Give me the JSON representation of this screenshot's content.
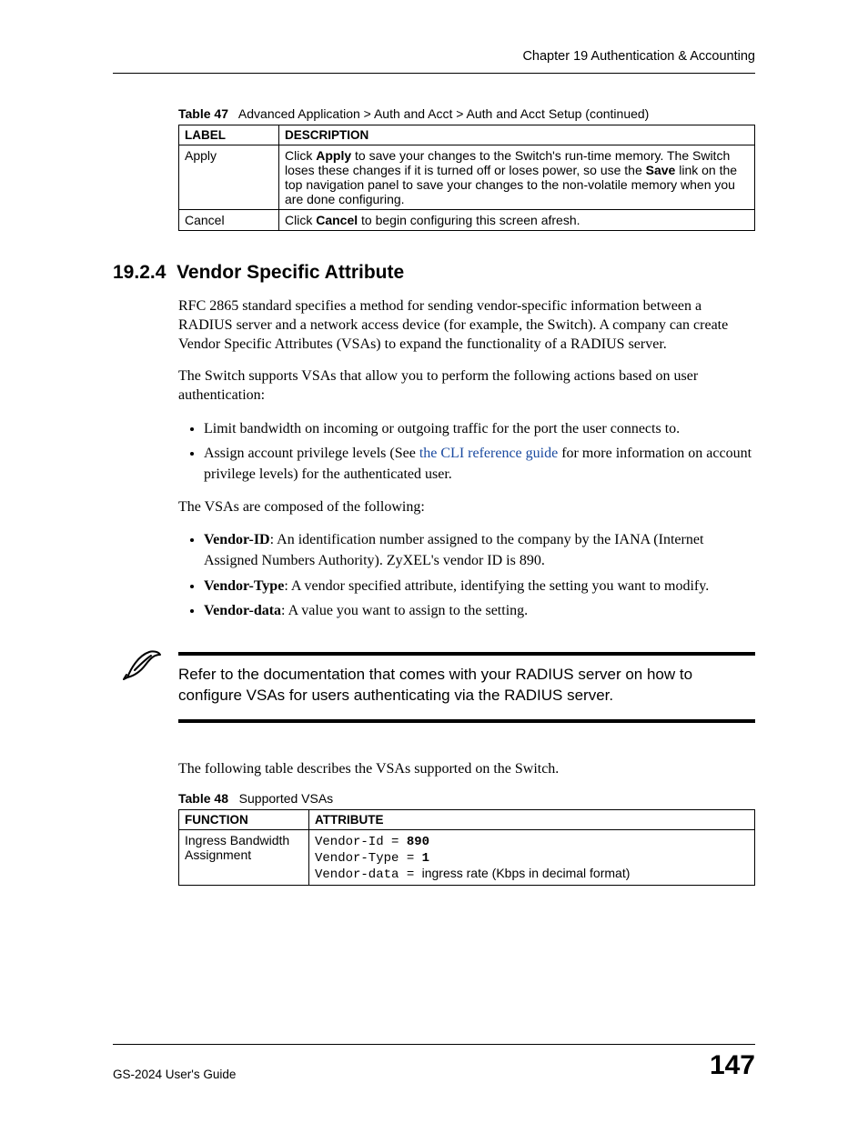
{
  "header": {
    "running_head": "Chapter 19 Authentication & Accounting"
  },
  "table47": {
    "caption_label": "Table 47",
    "caption_text": "Advanced Application > Auth and Acct > Auth and Acct Setup  (continued)",
    "head": {
      "c1": "LABEL",
      "c2": "DESCRIPTION"
    },
    "rows": [
      {
        "label": "Apply",
        "desc_pre": "Click ",
        "desc_b1": "Apply",
        "desc_mid": " to save your changes to the Switch's run-time memory. The Switch loses these changes if it is turned off or loses power, so use the ",
        "desc_b2": "Save",
        "desc_post": " link on the top navigation panel to save your changes to the non-volatile memory when you are done configuring."
      },
      {
        "label": "Cancel",
        "desc_pre": "Click ",
        "desc_b1": "Cancel",
        "desc_post": " to begin configuring this screen afresh."
      }
    ]
  },
  "section": {
    "number": "19.2.4",
    "title": "Vendor Specific Attribute"
  },
  "body": {
    "p1": "RFC 2865 standard specifies a method for sending vendor-specific information between a RADIUS server and a network access device (for example, the Switch). A company can create Vendor Specific Attributes (VSAs) to expand the functionality of a RADIUS server.",
    "p2": "The Switch supports VSAs that allow you to perform the following actions based on user authentication:",
    "ul1": {
      "li1": "Limit bandwidth on incoming or outgoing traffic for the port the user connects to.",
      "li2_pre": "Assign account privilege levels (See ",
      "li2_link": "the CLI reference guide",
      "li2_post": " for more information on account privilege levels) for the authenticated user."
    },
    "p3": "The VSAs are composed of the following:",
    "ul2": {
      "li1_b": "Vendor-ID",
      "li1_rest": ": An identification number assigned to the company by the IANA (Internet Assigned Numbers Authority). ZyXEL's vendor ID is 890.",
      "li2_b": "Vendor-Type",
      "li2_rest": ": A vendor specified attribute, identifying the setting you want to modify.",
      "li3_b": "Vendor-data",
      "li3_rest": ": A value you want to assign to the setting."
    },
    "note": "Refer to the documentation that comes with your RADIUS server on how to configure VSAs for users authenticating via the RADIUS server.",
    "p4": "The following table describes the VSAs supported on the Switch."
  },
  "table48": {
    "caption_label": "Table 48",
    "caption_text": "Supported VSAs",
    "head": {
      "c1": "FUNCTION",
      "c2": "ATTRIBUTE"
    },
    "row1": {
      "func": "Ingress Bandwidth Assignment",
      "l1_a": "Vendor-Id = ",
      "l1_b": "890",
      "l2_a": "Vendor-Type = ",
      "l2_b": "1",
      "l3_a": "Vendor-data = ",
      "l3_suffix": "ingress rate (Kbps in decimal format)"
    }
  },
  "footer": {
    "guide": "GS-2024 User's Guide",
    "page": "147"
  }
}
